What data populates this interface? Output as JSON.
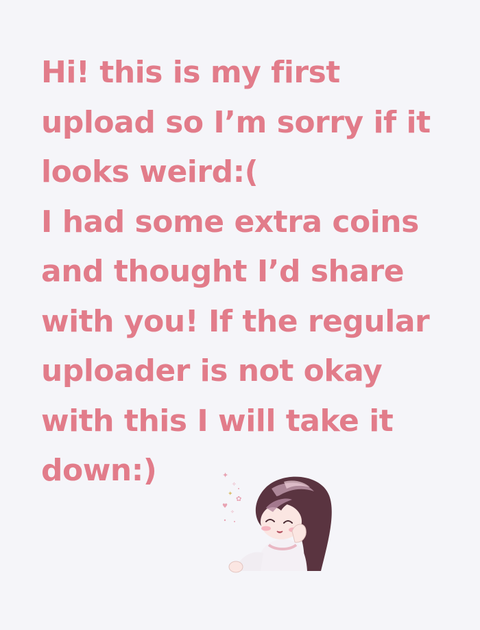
{
  "message": {
    "color": "#e27c8a",
    "lines": [
      "Hi! this is my first",
      "upload so I’m sorry if it",
      "looks weird:(",
      "I had some extra coins",
      "and thought I’d share",
      "with you! If the regular",
      "uploader is not okay",
      "with this I will take it",
      "down:)"
    ]
  },
  "sticker": {
    "subject": "chibi girl waving with sparkles",
    "hair_color": "#5a3440",
    "skin_color": "#fbe6e2",
    "sparkle_color": "#e8a3b3"
  }
}
